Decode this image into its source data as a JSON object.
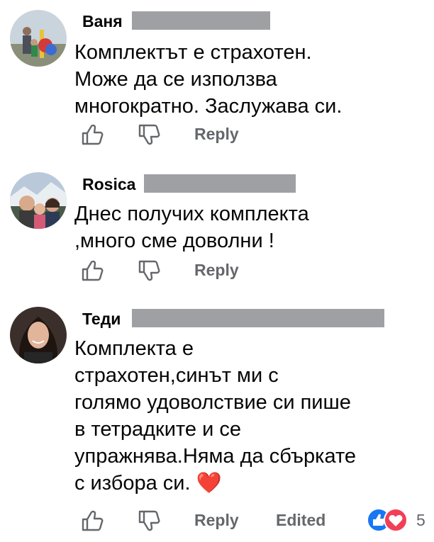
{
  "comments": [
    {
      "author": "Ваня",
      "text": "Комплектът е страхотен.\nМоже да се използва\nмногократно. Заслужава си.",
      "actions": {
        "reply": "Reply"
      }
    },
    {
      "author": "Rosica",
      "text": "Днес получих комплекта\n,много сме доволни !",
      "actions": {
        "reply": "Reply"
      }
    },
    {
      "author": "Теди",
      "text": "Комплекта е\nстрахотен,синът ми с\nголямо удоволствие си пише\nв тетрадките и се\nупражнява.Няма да сбъркате\nс избора си. ❤️",
      "actions": {
        "reply": "Reply",
        "edited": "Edited"
      },
      "reactions": {
        "icons": [
          "like-icon",
          "love-icon"
        ],
        "count": "5"
      }
    }
  ],
  "colors": {
    "redaction": "#9fa0a4",
    "secondary_text": "#65676b",
    "like_blue": "#1877f2",
    "love_red": "#f33e58"
  }
}
